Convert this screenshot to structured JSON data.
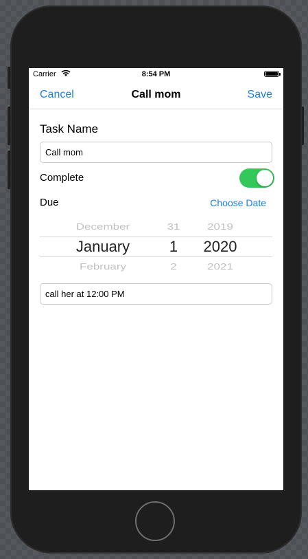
{
  "status_bar": {
    "carrier": "Carrier",
    "time": "8:54 PM"
  },
  "nav": {
    "cancel_label": "Cancel",
    "title": "Call mom",
    "save_label": "Save"
  },
  "form": {
    "task_name_label": "Task Name",
    "task_name_value": "Call mom",
    "complete_label": "Complete",
    "complete_on": true,
    "due_label": "Due",
    "choose_date_label": "Choose Date",
    "notes_value": "call her at 12:00 PM"
  },
  "date_picker": {
    "month": {
      "prev": "December",
      "selected": "January",
      "next": "February"
    },
    "day": {
      "prev": "31",
      "selected": "1",
      "next": "2"
    },
    "year": {
      "prev": "2019",
      "selected": "2020",
      "next": "2021"
    }
  },
  "colors": {
    "accent": "#1a7ff0",
    "toggle_on": "#34c759",
    "device_body": "#1e1e1e"
  },
  "icons": [
    "wifi-icon",
    "battery-icon",
    "home-button"
  ]
}
